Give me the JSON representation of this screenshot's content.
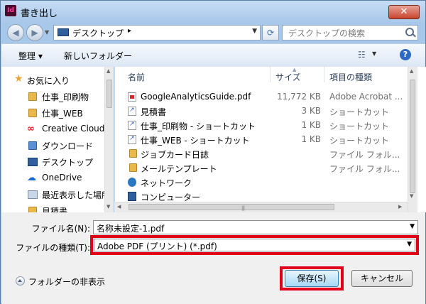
{
  "window": {
    "title": "書き出し",
    "app_icon_text": "Id",
    "close_glyph": "✕"
  },
  "address": {
    "nav_back": "◀",
    "nav_forward": "▶",
    "location": "デスクトップ",
    "separator": "▸",
    "search_placeholder": "デスクトップの検索",
    "refresh_glyph": "⟳"
  },
  "toolbar": {
    "organize": "整理 ▾",
    "new_folder": "新しいフォルダー",
    "view_glyph": "☷",
    "help_glyph": "?"
  },
  "nav_pane": {
    "items": [
      {
        "label": "お気に入り",
        "icon": "star-icon"
      },
      {
        "label": "仕事_印刷物",
        "icon": "folder-icon"
      },
      {
        "label": "仕事_WEB",
        "icon": "folder-icon"
      },
      {
        "label": "Creative Cloud",
        "icon": "creative-cloud-icon"
      },
      {
        "label": "ダウンロード",
        "icon": "download-folder-icon"
      },
      {
        "label": "デスクトップ",
        "icon": "desktop-icon"
      },
      {
        "label": "OneDrive",
        "icon": "onedrive-icon"
      },
      {
        "label": "最近表示した場所",
        "icon": "recent-places-icon"
      },
      {
        "label": "見積書",
        "icon": "folder-icon"
      }
    ]
  },
  "file_list": {
    "columns": {
      "name": "名前",
      "size": "サイズ",
      "type": "項目の種類"
    },
    "rows": [
      {
        "name": "GoogleAnalyticsGuide.pdf",
        "size": "11,772 KB",
        "type": "Adobe Acrobat ...",
        "icon": "pdf-icon"
      },
      {
        "name": "見積書",
        "size": "3 KB",
        "type": "ショートカット",
        "icon": "shortcut-icon"
      },
      {
        "name": "仕事_印刷物 - ショートカット",
        "size": "1 KB",
        "type": "ショートカット",
        "icon": "shortcut-icon"
      },
      {
        "name": "仕事_WEB - ショートカット",
        "size": "1 KB",
        "type": "ショートカット",
        "icon": "shortcut-icon"
      },
      {
        "name": "ジョブカード日誌",
        "size": "",
        "type": "ファイル フォル...",
        "icon": "folder-icon"
      },
      {
        "name": "メールテンプレート",
        "size": "",
        "type": "ファイル フォル...",
        "icon": "folder-icon"
      },
      {
        "name": "ネットワーク",
        "size": "",
        "type": "",
        "icon": "network-icon"
      },
      {
        "name": "コンピューター",
        "size": "",
        "type": "",
        "icon": "computer-icon"
      }
    ]
  },
  "form": {
    "filename_label": "ファイル名(N):",
    "filename_value": "名称未設定-1.pdf",
    "filetype_label": "ファイルの種類(T):",
    "filetype_value": "Adobe PDF (プリント) (*.pdf)"
  },
  "footer": {
    "hide_folders": "フォルダーの非表示",
    "save": "保存(S)",
    "cancel": "キャンセル"
  },
  "colors": {
    "highlight": "#e0001a",
    "frame": "#a8c8ea"
  }
}
